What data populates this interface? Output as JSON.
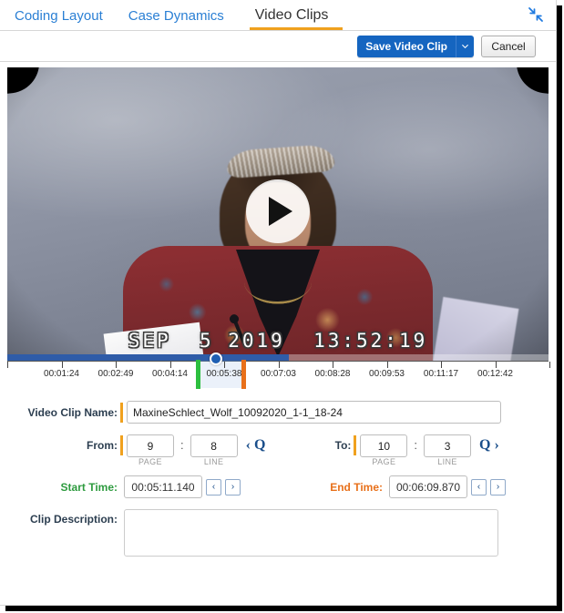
{
  "tabs": [
    {
      "label": "Coding Layout",
      "active": false
    },
    {
      "label": "Case Dynamics",
      "active": false
    },
    {
      "label": "Video Clips",
      "active": true
    }
  ],
  "window": {
    "collapse_icon": "collapse-arrows-icon"
  },
  "toolbar": {
    "save_label": "Save Video Clip",
    "save_caret_icon": "chevron-down-icon",
    "cancel_label": "Cancel"
  },
  "video": {
    "overlay_timestamp": "SEP  5 2019  13:52:19",
    "play_icon": "play-icon",
    "progress_percent": 52
  },
  "timeline": {
    "ticks": [
      "00:01:24",
      "00:02:49",
      "00:04:14",
      "00:05:38",
      "00:07:03",
      "00:08:28",
      "00:09:53",
      "00:11:17",
      "00:12:42"
    ],
    "selection_start_label": "00:05:38",
    "playhead_position_percent": 38.5,
    "selection_left_percent": 35.4,
    "selection_right_percent": 43.6,
    "handle_start_color": "#2cbf3f",
    "handle_end_color": "#e8701a"
  },
  "form": {
    "clip_name": {
      "label": "Video Clip Name:",
      "value": "MaxineSchlect_Wolf_10092020_1-1_18-24",
      "placeholder": ""
    },
    "from": {
      "label": "From:",
      "page": "9",
      "line": "8",
      "separator": ":",
      "page_caption": "PAGE",
      "line_caption": "LINE",
      "quote_button": "‹ Q"
    },
    "to": {
      "label": "To:",
      "page": "10",
      "line": "3",
      "separator": ":",
      "page_caption": "PAGE",
      "line_caption": "LINE",
      "quote_button": "Q ›"
    },
    "start_time": {
      "label": "Start Time:",
      "value": "00:05:11.140",
      "prev_icon": "‹",
      "next_icon": "›",
      "color": "#2e9b3f"
    },
    "end_time": {
      "label": "End Time:",
      "value": "00:06:09.870",
      "prev_icon": "‹",
      "next_icon": "›",
      "color": "#e8701a"
    },
    "description": {
      "label": "Clip Description:",
      "value": "",
      "placeholder": ""
    }
  }
}
